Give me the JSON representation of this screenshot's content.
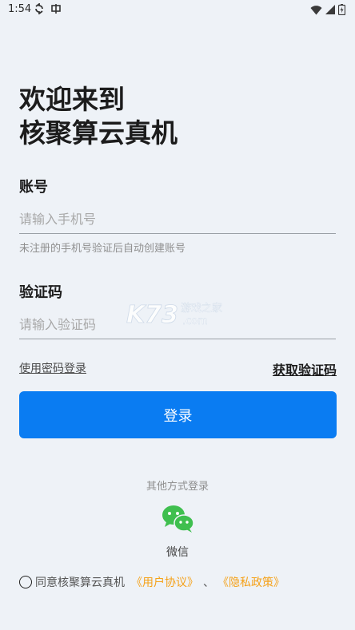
{
  "status_bar": {
    "time": "1:54",
    "icons": [
      "sync-icon",
      "notification-icon",
      "wifi-icon",
      "signal-icon",
      "battery-icon"
    ]
  },
  "heading": {
    "line1": "欢迎来到",
    "line2": "核聚算云真机"
  },
  "account": {
    "label": "账号",
    "placeholder": "请输入手机号",
    "hint": "未注册的手机号验证后自动创建账号"
  },
  "code": {
    "label": "验证码",
    "placeholder": "请输入验证码"
  },
  "links": {
    "password_login": "使用密码登录",
    "get_code": "获取验证码"
  },
  "login_button": "登录",
  "other_login": {
    "title": "其他方式登录",
    "wechat_label": "微信"
  },
  "agreement": {
    "prefix": "同意核聚算云真机",
    "user_agreement": "《用户协议》",
    "separator": "、",
    "privacy_policy": "《隐私政策》"
  },
  "colors": {
    "primary": "#0a7cf2",
    "background": "#eef2f7",
    "link_accent": "#f5a21a",
    "wechat_green": "#3fbf4f"
  }
}
